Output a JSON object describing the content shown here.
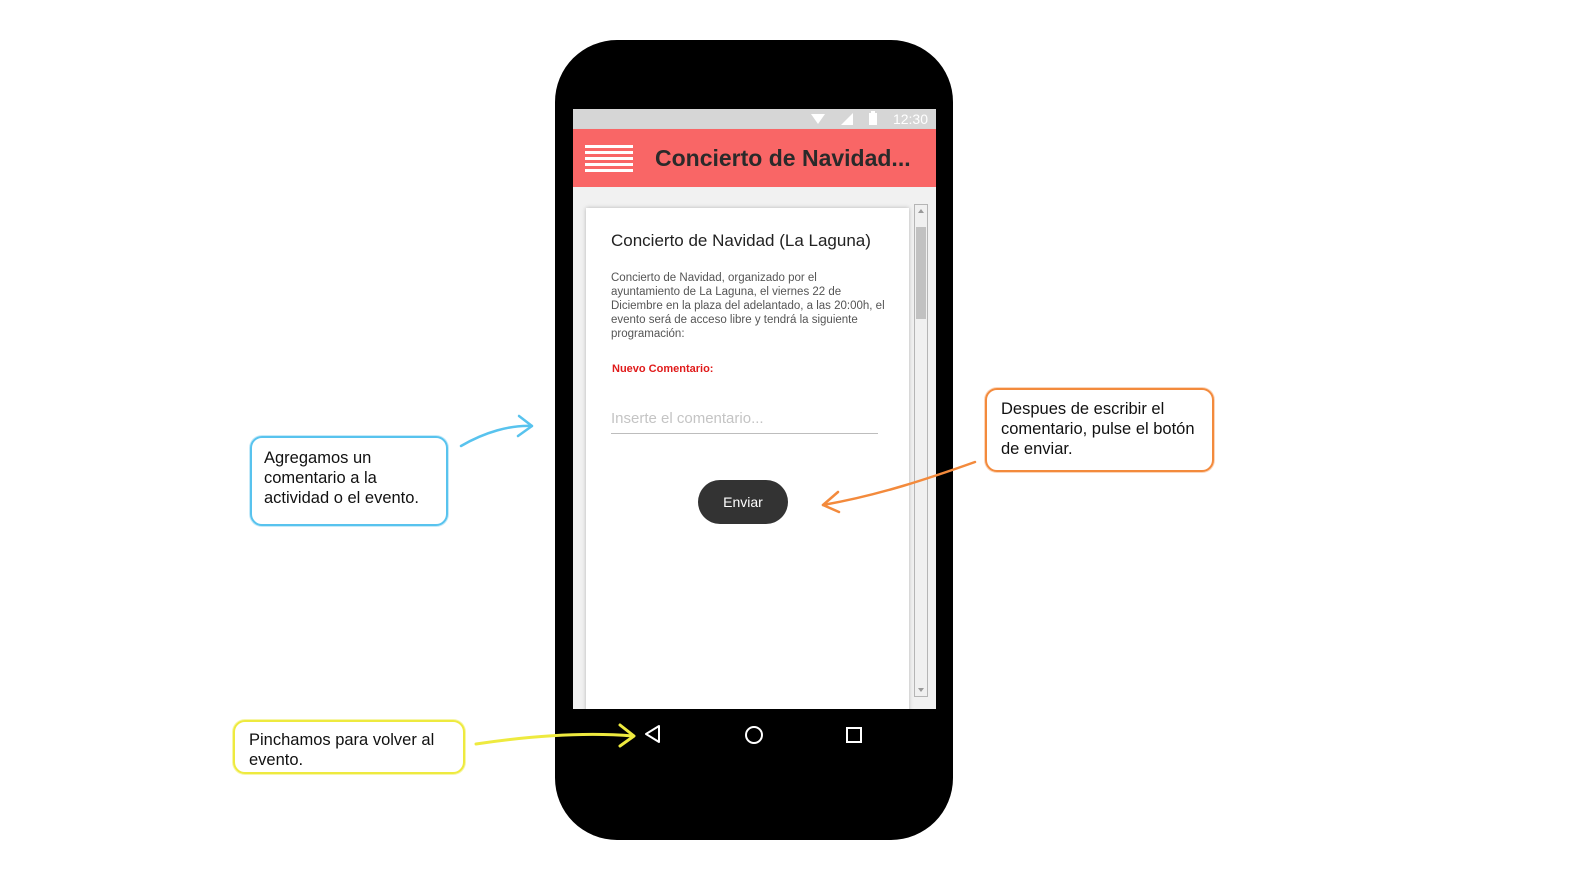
{
  "status_bar": {
    "time": "12:30",
    "wifi_icon": "wifi-icon",
    "signal_icon": "signal-icon",
    "battery_icon": "battery-icon"
  },
  "app_bar": {
    "menu_icon": "hamburger-menu-icon",
    "title": "Concierto de Navidad...",
    "color": "#f96666"
  },
  "event": {
    "title": "Concierto de Navidad (La Laguna)",
    "description": "Concierto de Navidad, organizado por el ayuntamiento de La Laguna, el viernes 22 de Diciembre en la plaza del adelantado, a las 20:00h, el evento será de acceso libre y tendrá la siguiente programación:"
  },
  "comment_form": {
    "label": "Nuevo Comentario:",
    "placeholder": "Inserte el comentario...",
    "value": "",
    "send_label": "Enviar"
  },
  "nav_bar": {
    "back_icon": "back-triangle-icon",
    "home_icon": "home-circle-icon",
    "recents_icon": "recents-square-icon"
  },
  "annotations": {
    "blue": "Agregamos un comentario a la actividad o el evento.",
    "orange": "Despues de escribir el comentario, pulse el botón de enviar.",
    "yellow": "Pinchamos para volver al evento."
  },
  "colors": {
    "blue": "#58c3ee",
    "orange": "#f38a3c",
    "yellow": "#eeea3f",
    "label_red": "#e01a1a",
    "button_dark": "#333333"
  }
}
